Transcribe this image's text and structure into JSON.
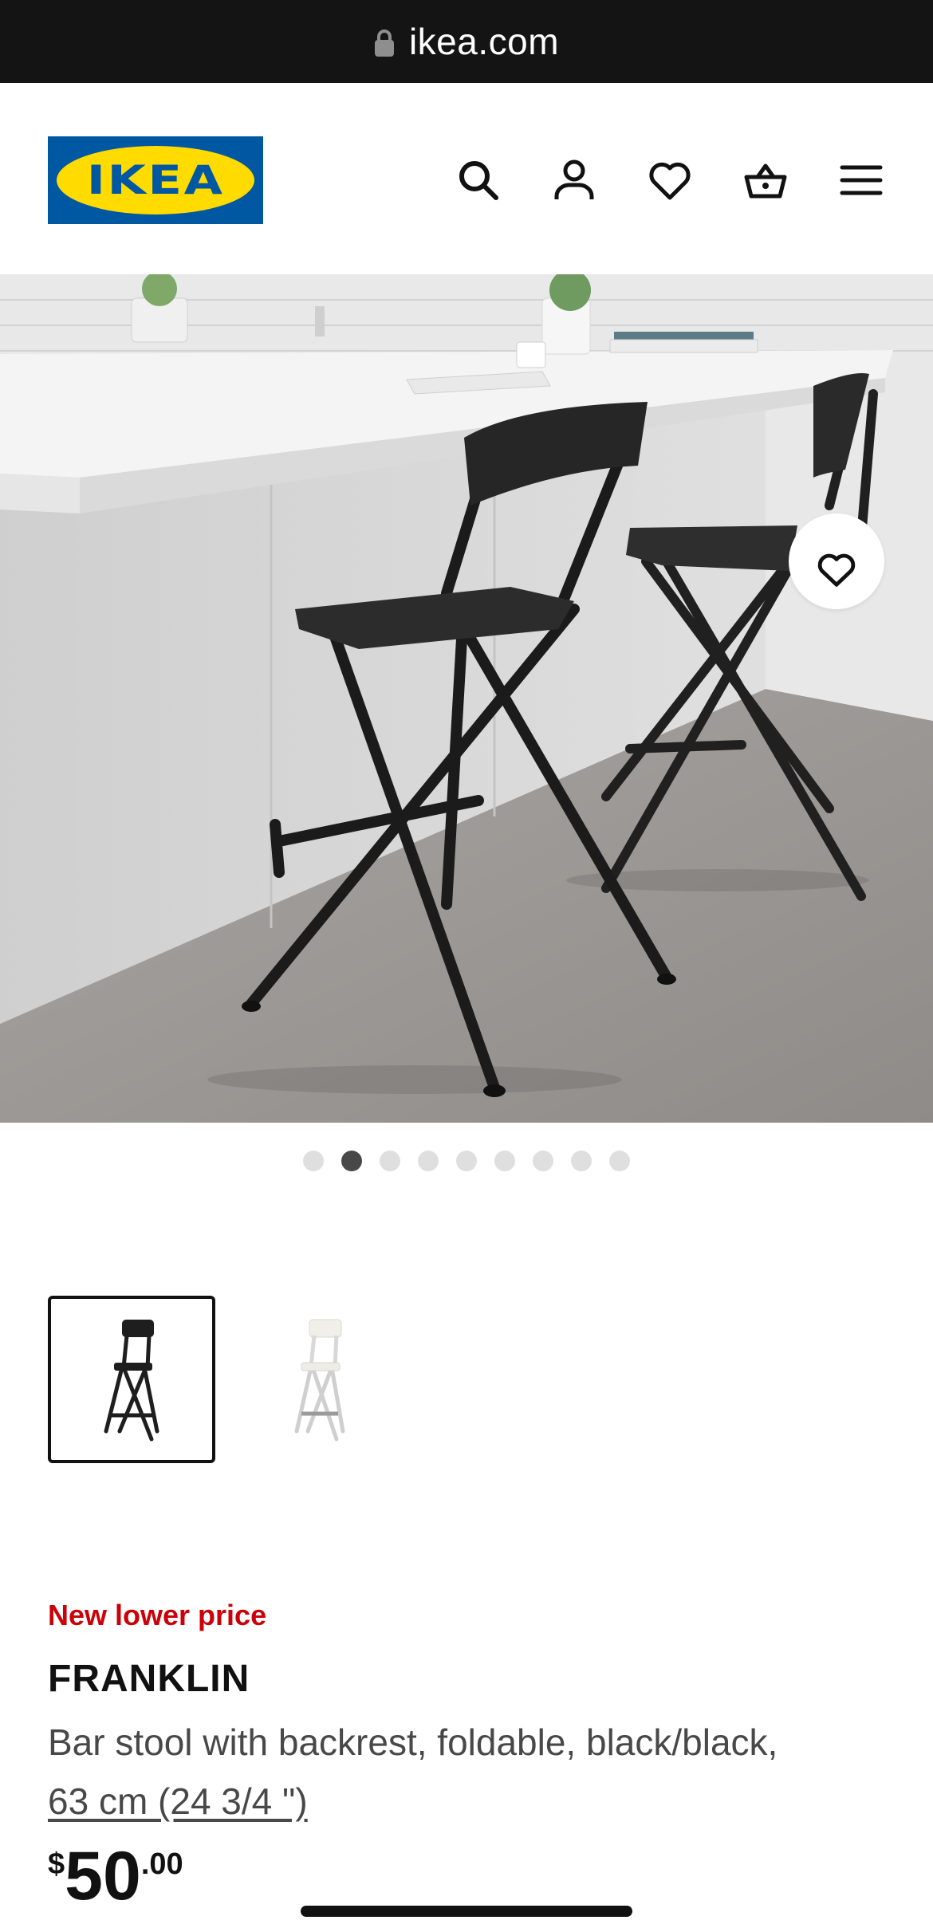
{
  "browser": {
    "url": "ikea.com",
    "lock_icon": "lock-icon"
  },
  "header": {
    "logo_text": "IKEA",
    "icons": [
      "search-icon",
      "account-icon",
      "heart-icon",
      "cart-icon",
      "menu-icon"
    ]
  },
  "gallery": {
    "total_images": 9,
    "active_index": 1
  },
  "variants": [
    {
      "name": "black/black",
      "selected": true
    },
    {
      "name": "white/silver",
      "selected": false
    }
  ],
  "product": {
    "promo": "New lower price",
    "name": "FRANKLIN",
    "description": "Bar stool with backrest, foldable, black/black,",
    "size_link": "63 cm (24 3/4 \")",
    "price": {
      "currency": "$",
      "integer": "50",
      "decimal": ".00"
    }
  },
  "colors": {
    "ikea_blue": "#0058a3",
    "ikea_yellow": "#ffdb00",
    "promo_red": "#cc0008"
  }
}
